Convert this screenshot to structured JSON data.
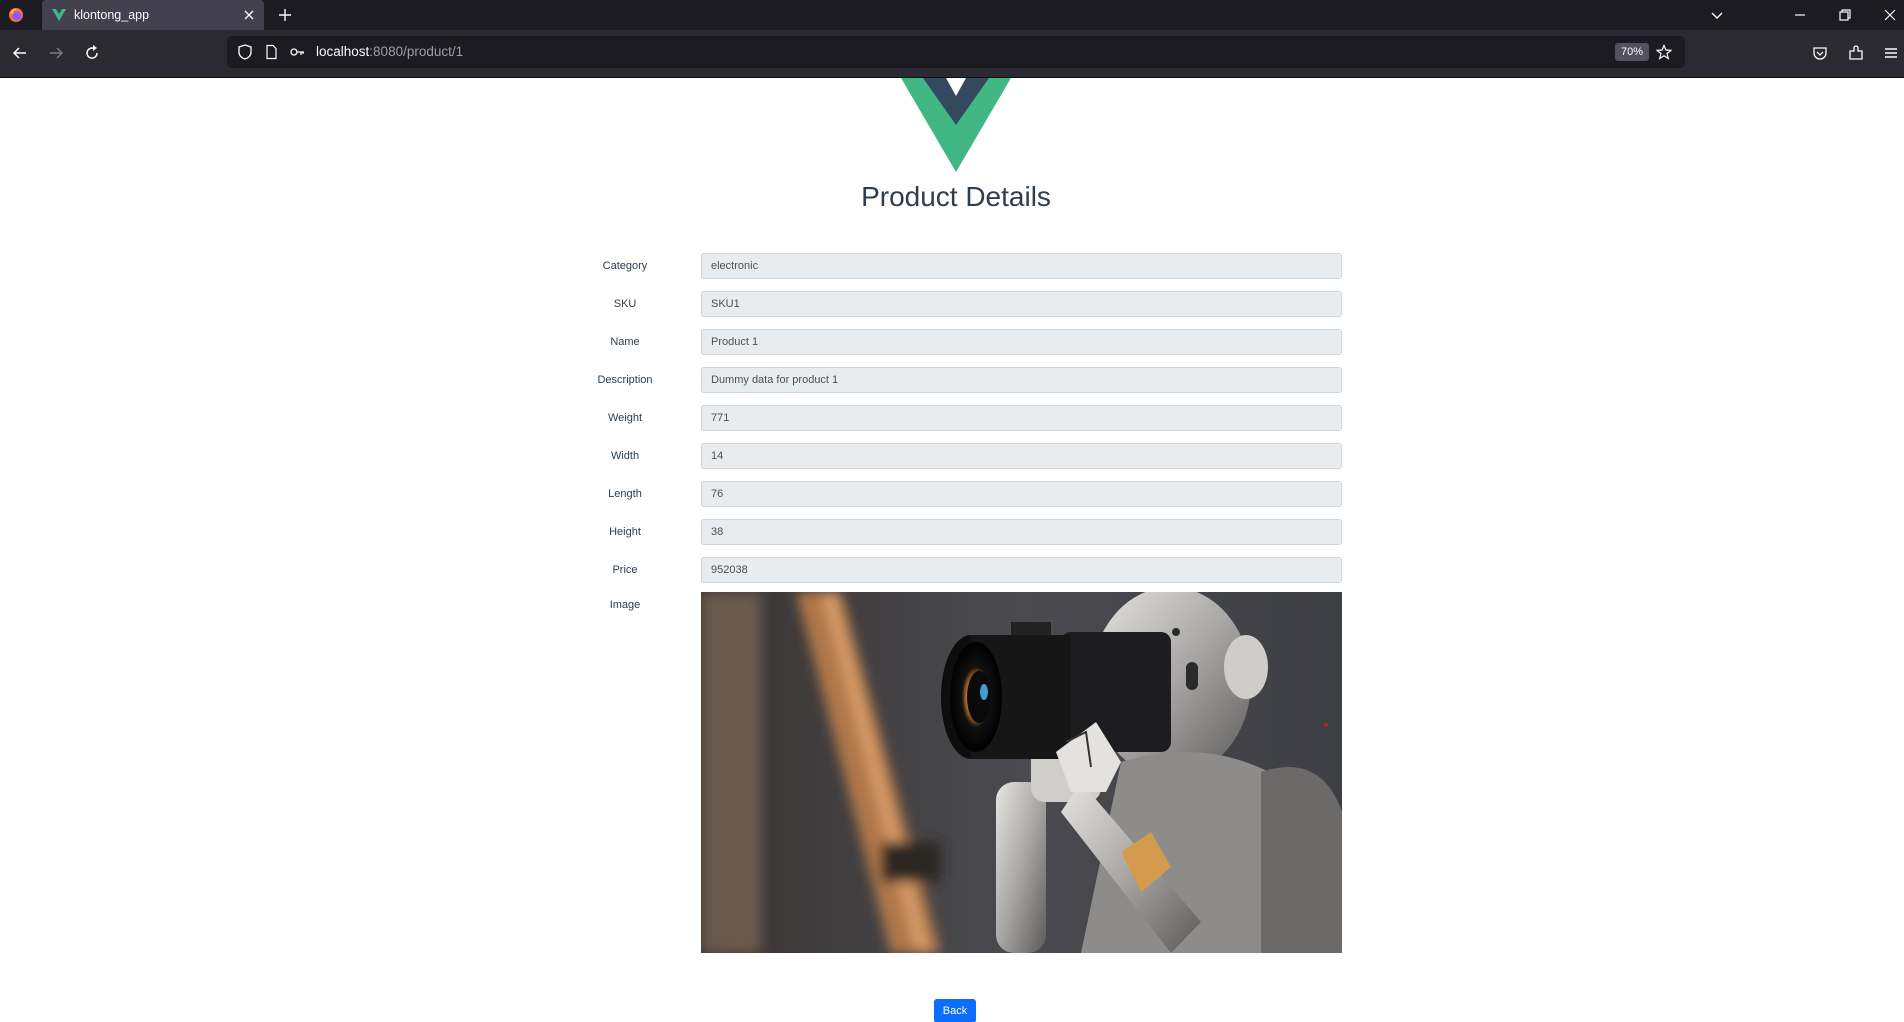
{
  "browser": {
    "tab_title": "klontong_app",
    "url_host": "localhost",
    "url_path": ":8080/product/1",
    "zoom": "70%"
  },
  "page": {
    "title": "Product Details",
    "fields": [
      {
        "label": "Category",
        "value": "electronic"
      },
      {
        "label": "SKU",
        "value": "SKU1"
      },
      {
        "label": "Name",
        "value": "Product 1"
      },
      {
        "label": "Description",
        "value": "Dummy data for product 1"
      },
      {
        "label": "Weight",
        "value": "771"
      },
      {
        "label": "Width",
        "value": "14"
      },
      {
        "label": "Length",
        "value": "76"
      },
      {
        "label": "Height",
        "value": "38"
      },
      {
        "label": "Price",
        "value": "952038"
      }
    ],
    "image_label": "Image",
    "back_label": "Back"
  },
  "colors": {
    "vue_green": "#41b883",
    "vue_dark": "#35495e",
    "button_blue": "#0d6efd",
    "heading": "#2c3e50"
  },
  "icons": [
    "firefox-icon",
    "vue-favicon-icon",
    "close-tab-icon",
    "new-tab-icon",
    "list-tabs-icon",
    "minimize-icon",
    "restore-icon",
    "close-window-icon",
    "back-arrow-icon",
    "forward-arrow-icon",
    "reload-icon",
    "shield-icon",
    "page-icon",
    "key-icon",
    "star-icon",
    "pocket-icon",
    "extensions-icon",
    "menu-icon"
  ]
}
